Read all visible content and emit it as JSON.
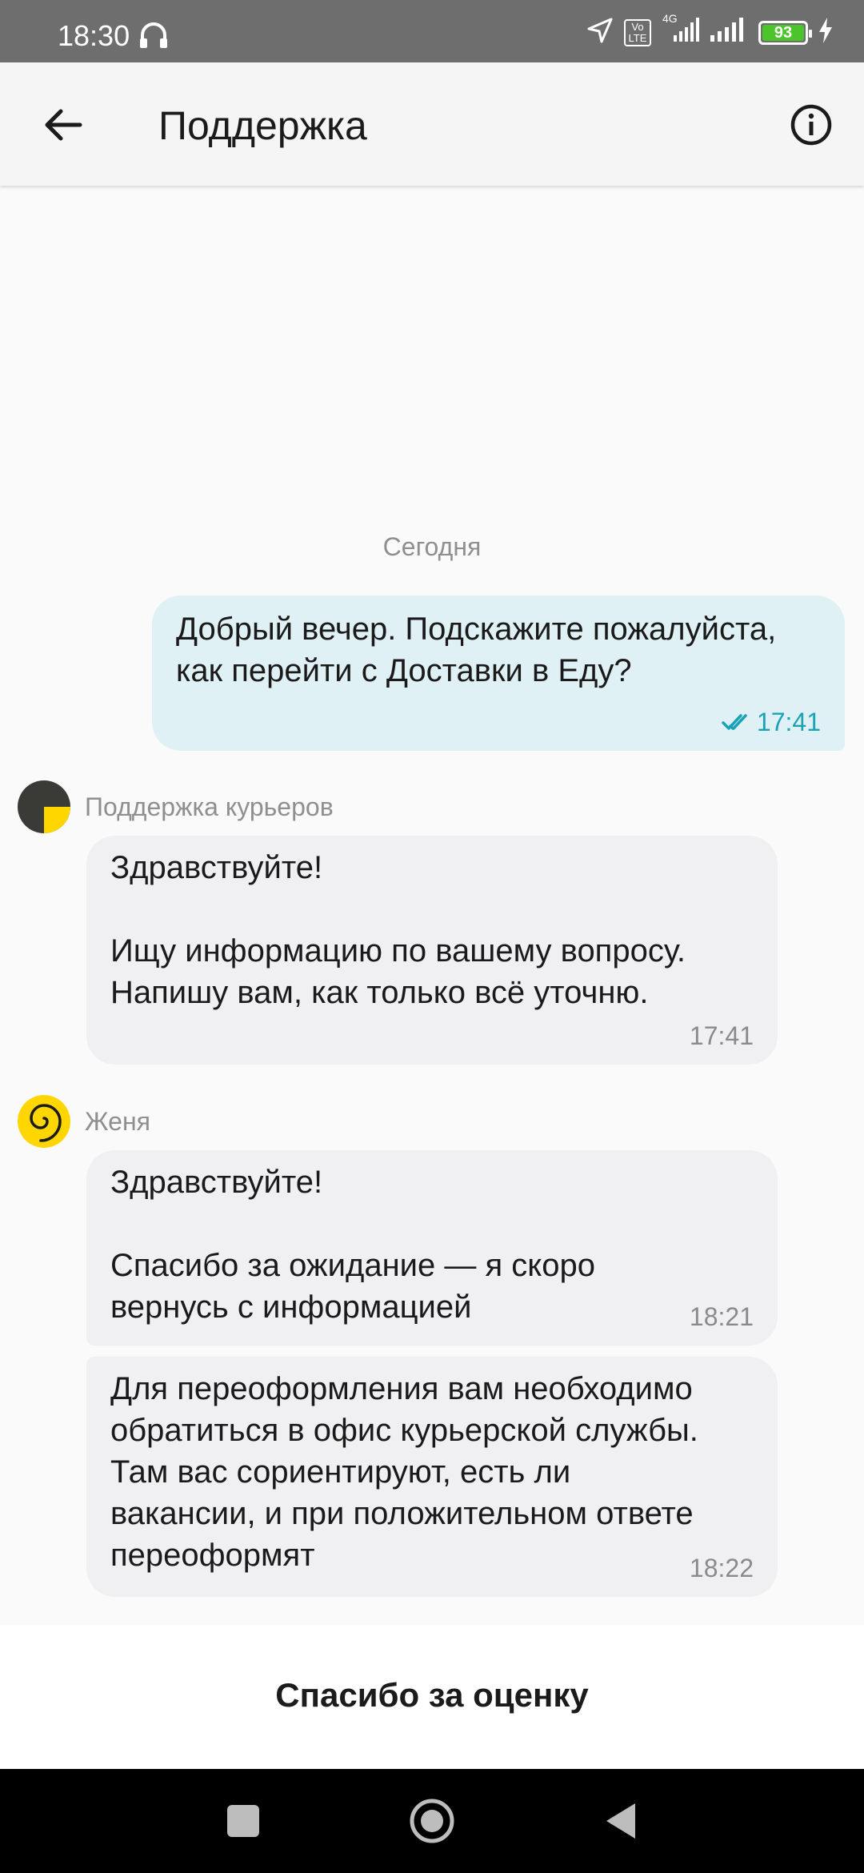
{
  "status_bar": {
    "time": "18:30",
    "net_label": "4G",
    "volte_label": "Vo LTE",
    "battery": "93"
  },
  "header": {
    "title": "Поддержка"
  },
  "chat": {
    "date_separator": "Сегодня",
    "messages": [
      {
        "direction": "out",
        "text": "Добрый вечер. Подскажите пожалуйста, как перейти с Доставки в Еду?",
        "time": "17:41"
      },
      {
        "direction": "in",
        "sender": "Поддержка курьеров",
        "text": "Здравствуйте!\n\nИщу информацию по вашему вопросу. Напишу вам, как только всё уточню.",
        "time": "17:41"
      },
      {
        "direction": "in",
        "sender": "Женя",
        "text": "Здравствуйте!\n\nСпасибо за ожидание —  я скоро вернусь с информацией",
        "time": "18:21"
      },
      {
        "direction": "in",
        "text": "Для переоформления вам необходимо обратиться в офис курьерской службы. Там вас сориентируют, есть ли вакансии, и при положительном ответе переоформят",
        "time": "18:22"
      }
    ]
  },
  "rating": {
    "label": "Спасибо за оценку"
  },
  "colors": {
    "outgoing_bubble": "#dff1f4",
    "incoming_bubble": "#f0f0f2",
    "read_ticks": "#1aa3b5",
    "avatar_yellow": "#ffd600"
  },
  "icons": [
    "headset-icon",
    "location-arrow-icon",
    "signal-icon",
    "battery-icon",
    "charging-icon",
    "back-arrow-icon",
    "info-icon",
    "double-check-icon",
    "home-icon",
    "recents-icon",
    "back-nav-icon"
  ]
}
